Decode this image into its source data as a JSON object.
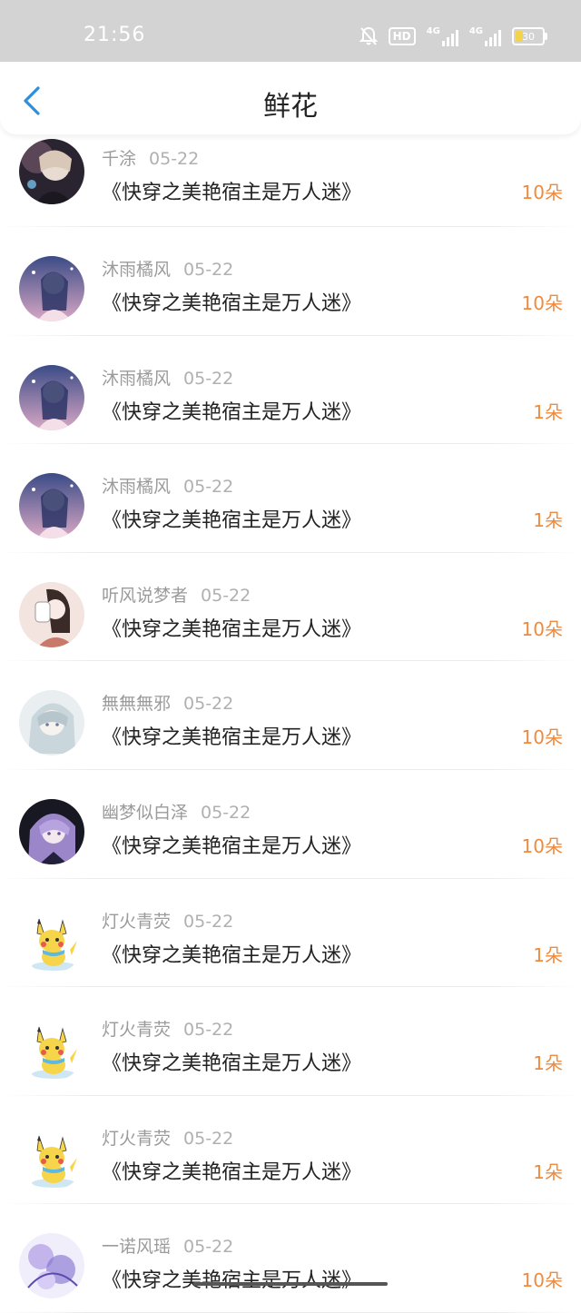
{
  "status_bar": {
    "time": "21:56",
    "hd": "HD",
    "net1": "4G",
    "net2": "4G",
    "battery": "30",
    "battery_level": 0.3
  },
  "header": {
    "title": "鲜花",
    "back_icon": "chevron-left-icon",
    "accent": "#2f8fdd"
  },
  "colors": {
    "count": "#f08a3c",
    "username": "#9b9b9b"
  },
  "items": [
    {
      "user": "千涂",
      "date": "05-22",
      "book": "《快穿之美艳宿主是万人迷》",
      "count": "10朵",
      "avatar": "dark-portrait"
    },
    {
      "user": "沐雨橘风",
      "date": "05-22",
      "book": "《快穿之美艳宿主是万人迷》",
      "count": "10朵",
      "avatar": "blue-night"
    },
    {
      "user": "沐雨橘风",
      "date": "05-22",
      "book": "《快穿之美艳宿主是万人迷》",
      "count": "1朵",
      "avatar": "blue-night"
    },
    {
      "user": "沐雨橘风",
      "date": "05-22",
      "book": "《快穿之美艳宿主是万人迷》",
      "count": "1朵",
      "avatar": "blue-night"
    },
    {
      "user": "听风说梦者",
      "date": "05-22",
      "book": "《快穿之美艳宿主是万人迷》",
      "count": "10朵",
      "avatar": "masked-girl"
    },
    {
      "user": "無無無邪",
      "date": "05-22",
      "book": "《快穿之美艳宿主是万人迷》",
      "count": "10朵",
      "avatar": "silver-hair"
    },
    {
      "user": "幽梦似白泽",
      "date": "05-22",
      "book": "《快穿之美艳宿主是万人迷》",
      "count": "10朵",
      "avatar": "purple-hair"
    },
    {
      "user": "灯火青荧",
      "date": "05-22",
      "book": "《快穿之美艳宿主是万人迷》",
      "count": "1朵",
      "avatar": "pikachu"
    },
    {
      "user": "灯火青荧",
      "date": "05-22",
      "book": "《快穿之美艳宿主是万人迷》",
      "count": "1朵",
      "avatar": "pikachu"
    },
    {
      "user": "灯火青荧",
      "date": "05-22",
      "book": "《快穿之美艳宿主是万人迷》",
      "count": "1朵",
      "avatar": "pikachu"
    },
    {
      "user": "一诺风瑶",
      "date": "05-22",
      "book": "《快穿之美艳宿主是万人迷》",
      "count": "10朵",
      "avatar": "lavender-art"
    }
  ]
}
